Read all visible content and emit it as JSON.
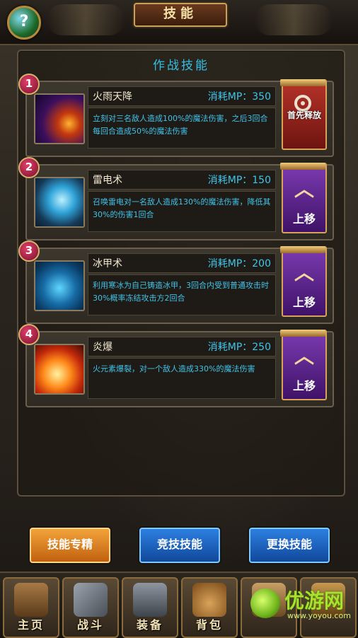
{
  "header": {
    "title": "技能",
    "help_glyph": "?"
  },
  "panel": {
    "title": "作战技能"
  },
  "skills": [
    {
      "index": "1",
      "name": "火雨天降",
      "mp": "消耗MP：350",
      "desc": "立刻对三名敌人造成100%的魔法伤害，之后3回合每回合造成50%的魔法伤害",
      "action": "首先释放",
      "icon": "fire-rain-icon"
    },
    {
      "index": "2",
      "name": "雷电术",
      "mp": "消耗MP：150",
      "desc": "召唤雷电对一名敌人造成130%的魔法伤害，降低其30%的伤害1回合",
      "action": "上移",
      "icon": "thunder-icon"
    },
    {
      "index": "3",
      "name": "冰甲术",
      "mp": "消耗MP：200",
      "desc": "利用寒冰为自己铸造冰甲，3回合内受到普通攻击时30%概率冻结攻击方2回合",
      "action": "上移",
      "icon": "ice-armor-icon"
    },
    {
      "index": "4",
      "name": "炎爆",
      "mp": "消耗MP：250",
      "desc": "火元素爆裂，对一个敌人造成330%的魔法伤害",
      "action": "上移",
      "icon": "flame-burst-icon"
    }
  ],
  "buttons": {
    "specialize": "技能专精",
    "arena": "竞技技能",
    "change": "更换技能"
  },
  "nav": [
    {
      "label": "主页",
      "icon": "gate-icon"
    },
    {
      "label": "战斗",
      "icon": "crossed-swords-icon"
    },
    {
      "label": "装备",
      "icon": "armor-icon"
    },
    {
      "label": "背包",
      "icon": "bag-icon"
    },
    {
      "label": "",
      "icon": "scroll-icon"
    },
    {
      "label": "",
      "icon": "helmet-icon"
    }
  ],
  "watermark": {
    "text": "优游网",
    "sub": "www.yoyou.com"
  },
  "colors": {
    "accent_cyan": "#3fc6ea",
    "button_orange": "#e08a22",
    "button_blue": "#1f66c4",
    "ribbon_red": "#b63329",
    "ribbon_purple": "#7c3bb2"
  }
}
